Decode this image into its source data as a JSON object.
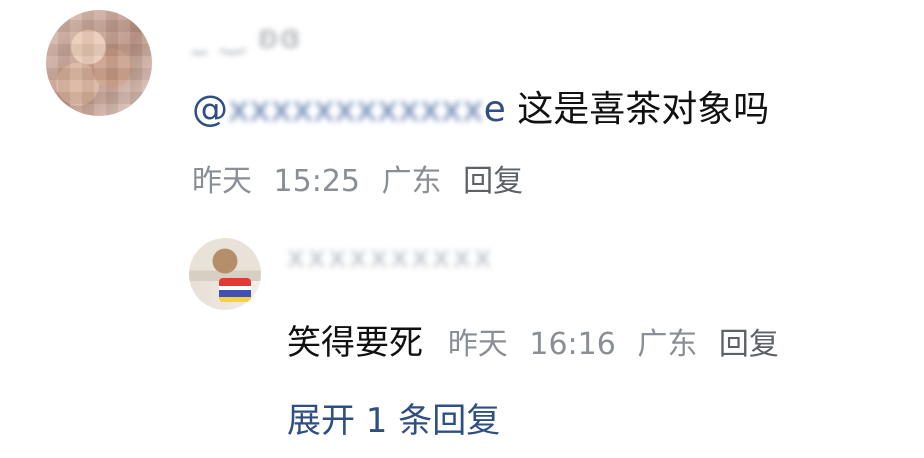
{
  "comment": {
    "username": "_ ‿ ʚɞ",
    "mention_visible_prefix": "@",
    "mention_blurred": "xxxxxxxxxxxx",
    "mention_visible_suffix": "e",
    "text": "这是喜茶对象吗",
    "meta": {
      "date": "昨天",
      "time": "15:25",
      "location": "广东",
      "reply_label": "回复"
    }
  },
  "reply": {
    "username": "xxxxxxxxxx",
    "text": "笑得要死",
    "meta": {
      "date": "昨天",
      "time": "16:16",
      "location": "广东",
      "reply_label": "回复"
    }
  },
  "expand_label": "展开 1 条回复"
}
